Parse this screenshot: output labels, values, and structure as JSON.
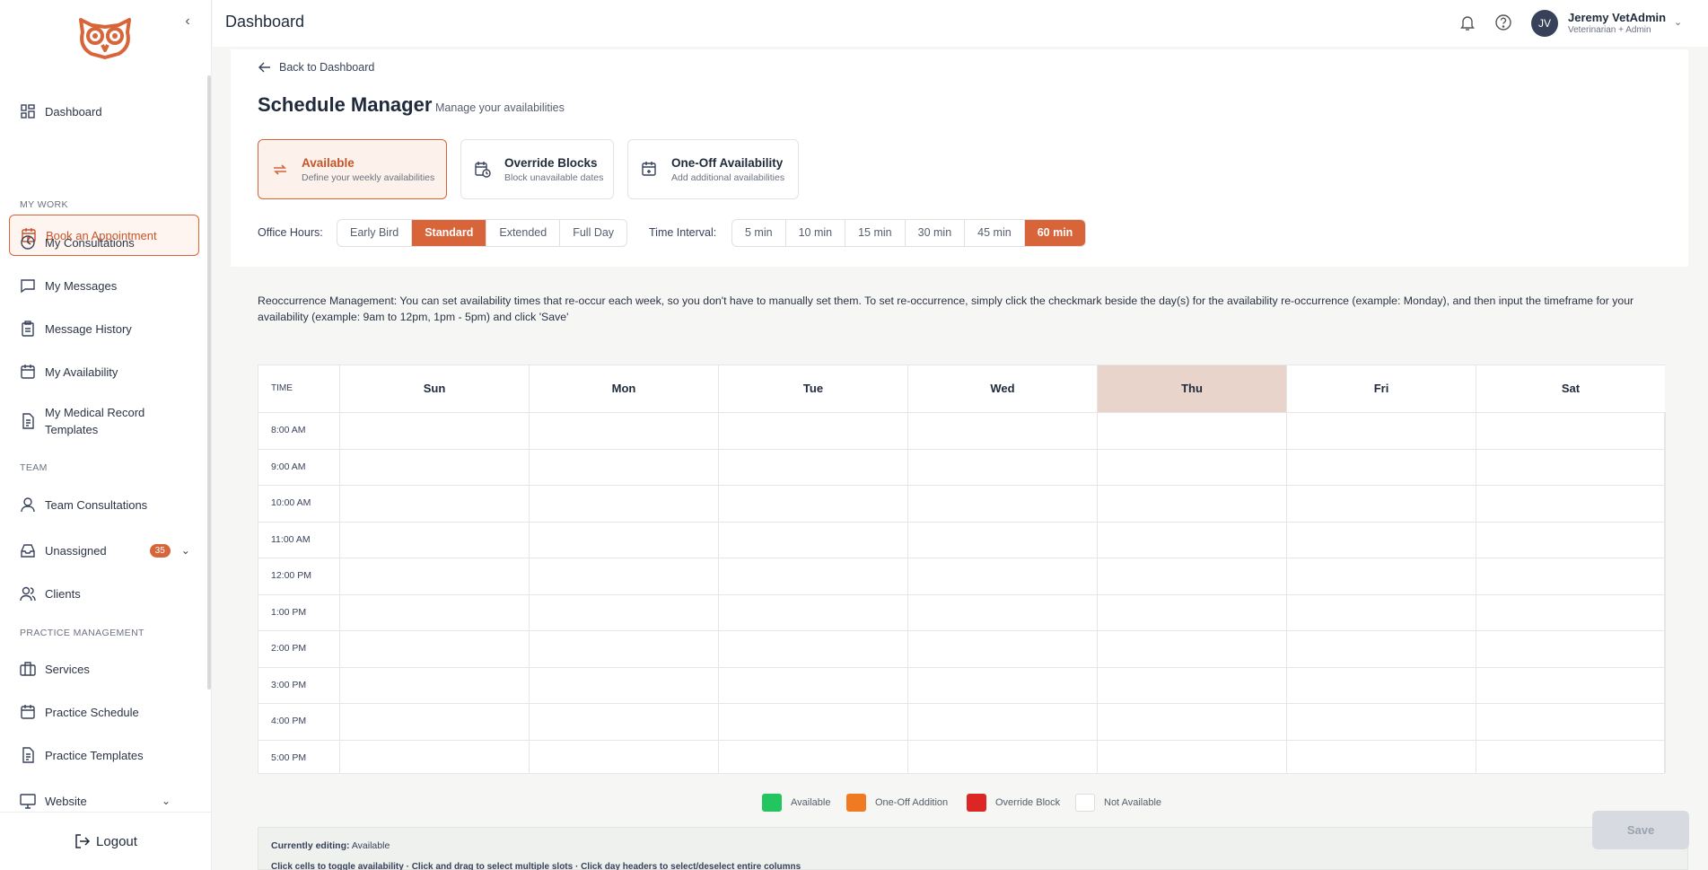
{
  "header": {
    "title": "Dashboard",
    "user": {
      "initials": "JV",
      "name": "Jeremy VetAdmin",
      "role": "Veterinarian + Admin"
    }
  },
  "sidebar": {
    "dashboard": "Dashboard",
    "book": "Book an Appointment",
    "sections": {
      "my_work": "MY WORK",
      "team": "TEAM",
      "practice": "PRACTICE MANAGEMENT"
    },
    "my_work": [
      "My Consultations",
      "My Messages",
      "Message History",
      "My Availability"
    ],
    "templates": "My Medical Record Templates",
    "team": {
      "consultations": "Team Consultations",
      "unassigned": "Unassigned",
      "unassigned_count": "35",
      "clients": "Clients"
    },
    "practice": [
      "Services",
      "Practice Schedule",
      "Practice Templates",
      "Website"
    ],
    "logout": "Logout"
  },
  "main": {
    "back": "Back to Dashboard",
    "title": "Schedule Manager",
    "subtitle": "Manage your availabilities",
    "modes": [
      {
        "label": "Available",
        "desc": "Define your weekly availabilities"
      },
      {
        "label": "Override Blocks",
        "desc": "Block unavailable dates"
      },
      {
        "label": "One-Off Availability",
        "desc": "Add additional availabilities"
      }
    ],
    "office_hours_label": "Office Hours:",
    "office_hours": [
      "Early Bird",
      "Standard",
      "Extended",
      "Full Day"
    ],
    "office_hours_selected": "Standard",
    "interval_label": "Time Interval:",
    "intervals": [
      "5 min",
      "10 min",
      "15 min",
      "30 min",
      "45 min",
      "60 min"
    ],
    "interval_selected": "60 min",
    "recurrence_text": "Reoccurrence Management: You can set availability times that re-occur each week, so you don't have to manually set them. To set re-occurrence, simply click the checkmark beside the day(s) for the availability re-occurrence (example: Monday), and then input the timeframe for your availability (example: 9am to 12pm, 1pm - 5pm) and click 'Save'"
  },
  "schedule": {
    "time_header": "TIME",
    "days": [
      "Sun",
      "Mon",
      "Tue",
      "Wed",
      "Thu",
      "Fri",
      "Sat"
    ],
    "highlighted_day": "Thu",
    "times": [
      "8:00 AM",
      "9:00 AM",
      "10:00 AM",
      "11:00 AM",
      "12:00 PM",
      "1:00 PM",
      "2:00 PM",
      "3:00 PM",
      "4:00 PM",
      "5:00 PM"
    ]
  },
  "legend": [
    {
      "label": "Available",
      "color": "#22c55e"
    },
    {
      "label": "One-Off Addition",
      "color": "#f07a22"
    },
    {
      "label": "Override Block",
      "color": "#dc2626"
    },
    {
      "label": "Not Available",
      "color": "#ffffff"
    }
  ],
  "editing": {
    "label": "Currently editing:",
    "value": "Available",
    "hint": "Click cells to toggle availability · Click and drag to select multiple slots · Click day headers to select/deselect entire columns"
  },
  "save": "Save",
  "colors": {
    "accent": "#d8643a",
    "today": "#e8d4ca"
  }
}
